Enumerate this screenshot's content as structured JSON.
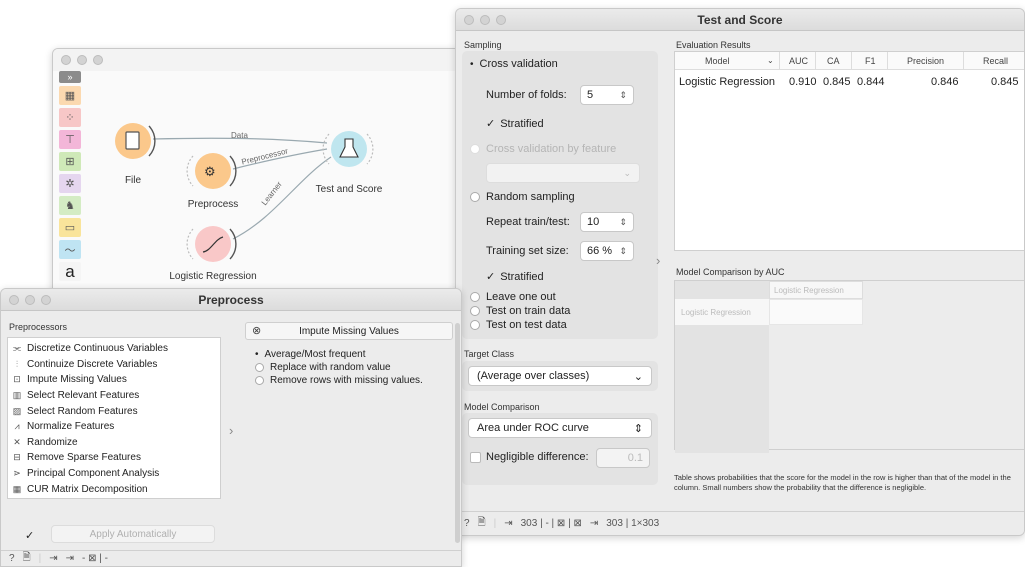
{
  "canvas": {
    "nodes": {
      "file": "File",
      "preprocess": "Preprocess",
      "test_and_score": "Test and Score",
      "logistic_regression": "Logistic Regression"
    },
    "links": {
      "data": "Data",
      "preprocessor": "Preprocessor",
      "learner": "Learner"
    },
    "toolbox_icons": [
      "expand-icon",
      "data-table-icon",
      "scatter-plot-icon",
      "tree-icon",
      "heatmap-icon",
      "network-icon",
      "model-icon",
      "image-icon",
      "line-chart-icon",
      "text-icon"
    ],
    "toolbox_text": "a",
    "colors": {
      "file": "#fbc88b",
      "preprocess": "#fbc88b",
      "model": "#f9c8c8",
      "evaluate": "#bfe6ef"
    }
  },
  "test_and_score": {
    "title": "Test and Score",
    "sampling": {
      "title": "Sampling",
      "cross_validation": "Cross validation",
      "folds_label": "Number of folds:",
      "folds_value": "5",
      "stratified": "Stratified",
      "cv_by_feature": "Cross validation by feature",
      "random_sampling": "Random sampling",
      "repeat_label": "Repeat train/test:",
      "repeat_value": "10",
      "train_size_label": "Training set size:",
      "train_size_value": "66 %",
      "stratified2": "Stratified",
      "leave_one_out": "Leave one out",
      "test_on_train": "Test on train data",
      "test_on_test": "Test on test data"
    },
    "target_class": {
      "title": "Target Class",
      "value": "(Average over classes)"
    },
    "model_comparison": {
      "title": "Model Comparison",
      "value": "Area under ROC curve",
      "negligible_label": "Negligible difference:",
      "negligible_value": "0.1"
    },
    "evaluation": {
      "title": "Evaluation Results",
      "columns": [
        "Model",
        "AUC",
        "CA",
        "F1",
        "Precision",
        "Recall"
      ],
      "row": [
        "Logistic Regression",
        "0.910",
        "0.845",
        "0.844",
        "0.846",
        "0.845"
      ]
    },
    "comparison_by_auc": {
      "title": "Model Comparison by AUC",
      "col_header": "Logistic Regression",
      "row_header": "Logistic Regression",
      "footnote": "Table shows probabilities that the score for the model in the row is higher than that of the model in the column. Small numbers show the probability that the difference is negligible."
    },
    "status": {
      "input": "303 | - | ⊠ | ⊠",
      "output": "303 | 1×303"
    }
  },
  "preprocess": {
    "title": "Preprocess",
    "list_title": "Preprocessors",
    "items": [
      "Discretize Continuous Variables",
      "Continuize Discrete Variables",
      "Impute Missing Values",
      "Select Relevant Features",
      "Select Random Features",
      "Normalize Features",
      "Randomize",
      "Remove Sparse Features",
      "Principal Component Analysis",
      "CUR Matrix Decomposition"
    ],
    "impute": {
      "title": "Impute Missing Values",
      "opt1": "Average/Most frequent",
      "opt2": "Replace with random value",
      "opt3": "Remove rows with missing values."
    },
    "apply_label": "Apply Automatically",
    "status": "- ⊠ | -"
  }
}
